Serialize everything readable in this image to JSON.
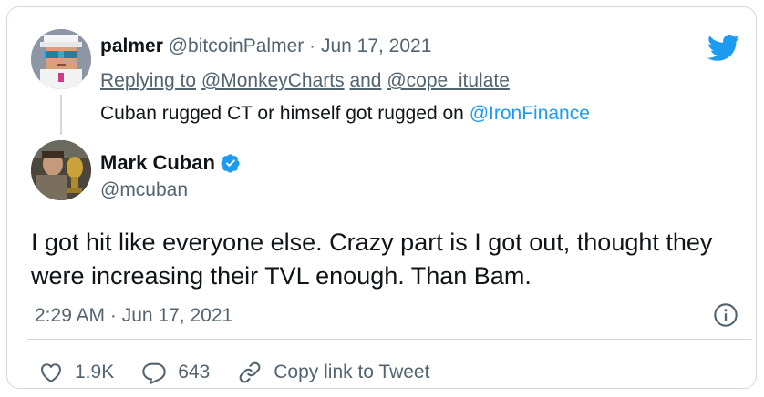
{
  "parent_tweet": {
    "display_name": "palmer",
    "handle": "@bitcoinPalmer",
    "separator": "·",
    "date": "Jun 17, 2021",
    "replying_prefix": "Replying to",
    "reply_to_1": "@MonkeyCharts",
    "reply_and": "and",
    "reply_to_2": "@cope_itulate",
    "text_before_mention": "Cuban rugged CT or himself got rugged on",
    "mention": "@IronFinance",
    "avatar_icon": "pixel-art-avatar-icon"
  },
  "main_tweet": {
    "display_name": "Mark Cuban",
    "handle": "@mcuban",
    "verified_icon": "verified-badge-icon",
    "text": "I got hit like everyone else. Crazy part is I got out, thought they were increasing their TVL enough. Than Bam.",
    "time": "2:29 AM",
    "separator": "·",
    "date": "Jun 17, 2021"
  },
  "actions": {
    "likes": "1.9K",
    "replies": "643",
    "copy_link_label": "Copy link to Tweet"
  },
  "colors": {
    "accent": "#1d9bf0",
    "muted_text": "#536471",
    "border": "#cfd9de",
    "text": "#0f1419"
  },
  "icons": {
    "brand": "twitter-bird-icon",
    "info": "info-icon",
    "like": "heart-icon",
    "reply": "reply-bubble-icon",
    "link": "link-icon"
  }
}
